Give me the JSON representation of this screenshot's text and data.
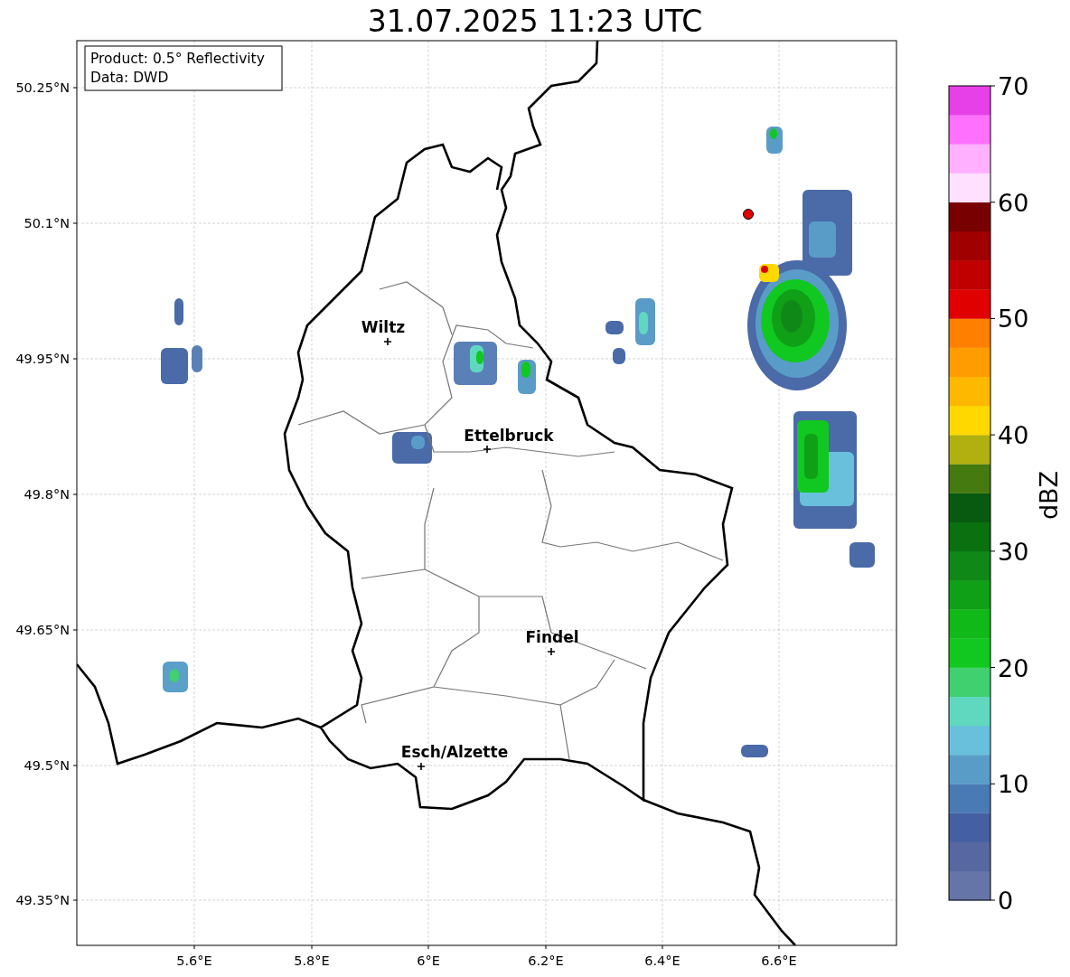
{
  "title": "31.07.2025 11:23 UTC",
  "info_box": {
    "lines": [
      "Product: 0.5° Reflectivity",
      "Data: DWD"
    ]
  },
  "map": {
    "y_ticks": [
      "50.25°N",
      "50.1°N",
      "49.95°N",
      "49.8°N",
      "49.65°N",
      "49.5°N",
      "49.35°N"
    ],
    "x_ticks": [
      "5.6°E",
      "5.8°E",
      "6°E",
      "6.2°E",
      "6.4°E",
      "6.6°E"
    ],
    "cities": [
      {
        "name": "Wiltz"
      },
      {
        "name": "Ettelbruck"
      },
      {
        "name": "Findel"
      },
      {
        "name": "Esch/Alzette"
      }
    ]
  },
  "colorbar": {
    "label": "dBZ",
    "ticks": [
      "70",
      "60",
      "50",
      "40",
      "30",
      "20",
      "10",
      "0"
    ],
    "bins": [
      {
        "color": "#6675a8"
      },
      {
        "color": "#56689f"
      },
      {
        "color": "#4560a2"
      },
      {
        "color": "#4a7ab4"
      },
      {
        "color": "#5a9cc8"
      },
      {
        "color": "#68c0dc"
      },
      {
        "color": "#60d8c0"
      },
      {
        "color": "#40d070"
      },
      {
        "color": "#10c820"
      },
      {
        "color": "#10b818"
      },
      {
        "color": "#10a018"
      },
      {
        "color": "#108818"
      },
      {
        "color": "#0a7010"
      },
      {
        "color": "#085a10"
      },
      {
        "color": "#457a10"
      },
      {
        "color": "#b0b010"
      },
      {
        "color": "#ffd800"
      },
      {
        "color": "#ffb800"
      },
      {
        "color": "#ff9c00"
      },
      {
        "color": "#ff8000"
      },
      {
        "color": "#e00000"
      },
      {
        "color": "#c00000"
      },
      {
        "color": "#a00000"
      },
      {
        "color": "#780000"
      },
      {
        "color": "#ffe0ff"
      },
      {
        "color": "#ffb0ff"
      },
      {
        "color": "#ff70ff"
      },
      {
        "color": "#e840e8"
      }
    ]
  }
}
